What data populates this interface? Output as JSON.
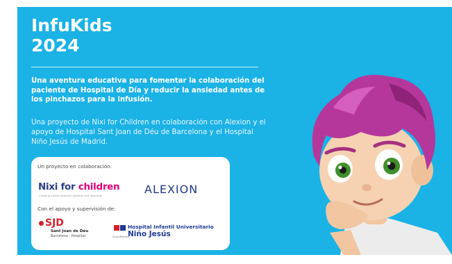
{
  "banner": {
    "title_line1": "InfuKids",
    "title_line2": "2024",
    "lead": "Una aventura educativa para fomentar la colaboración del paciente de Hospital de Día y reducir la ansiedad antes de los pinchazos para la infusión.",
    "description": "Una proyecto de Nixi for Children en colaboración con Alexion y el apoyo de Hospital Sant Joan de Déu de Barcelona y el Hospital Niño Jesús de Madrid.",
    "background_color": "#1bb2e6"
  },
  "partners": {
    "collab_label": "Un proyecto en colaboración:",
    "support_label": "Con el apoyo y supervisión de:",
    "nixi": {
      "part1": "Nixi for ",
      "part2": "children",
      "tagline": "Creating values between patients and hospitals"
    },
    "alexion": "ALEXION",
    "sjd": {
      "name": "SJD",
      "line1": "Sant Joan de Déu",
      "line2": "Barcelona · Hospital"
    },
    "hospital": {
      "line1": "Hospital Infantil Universitario",
      "line2": "Niño Jesús",
      "sub": "SaludMadrid"
    }
  },
  "illustration": {
    "subject": "cartoon-child-mascot",
    "hair_color": "#b6379c",
    "eye_color": "#3f8f2a"
  }
}
